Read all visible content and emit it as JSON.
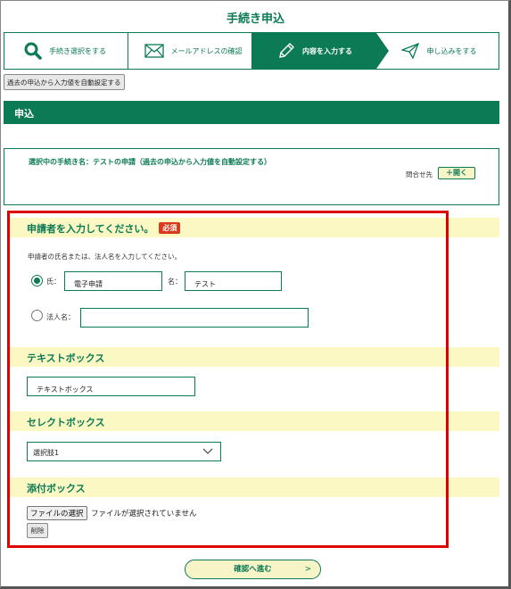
{
  "page": {
    "title": "手続き申込"
  },
  "steps": [
    {
      "label": "手続き選択をする",
      "icon": "search-icon",
      "active": false
    },
    {
      "label": "メールアドレスの確認",
      "icon": "mail-icon",
      "active": false
    },
    {
      "label": "内容を入力する",
      "icon": "pencil-icon",
      "active": true
    },
    {
      "label": "申し込みをする",
      "icon": "send-icon",
      "active": false
    }
  ],
  "autofill_button": "過去の申込から入力値を自動設定する",
  "section": {
    "title": "申込"
  },
  "info": {
    "procedure_label": "選択中の手続き名：",
    "procedure_name": "テストの申請（過去の申込から入力値を自動設定する）",
    "contact_label": "問合せ先",
    "open_button": "開く"
  },
  "applicant": {
    "heading": "申請者を入力してください。",
    "required_badge": "必須",
    "hint": "申請者の氏名または、法人名を入力してください。",
    "surname_label": "氏：",
    "surname_value": "電子申請",
    "given_label": "名：",
    "given_value": "テスト",
    "corp_label": "法人名：",
    "corp_value": ""
  },
  "textbox": {
    "heading": "テキストボックス",
    "value": "テキストボックス"
  },
  "selectbox": {
    "heading": "セレクトボックス",
    "selected": "選択肢1"
  },
  "attachment": {
    "heading": "添付ボックス",
    "choose_button": "ファイルの選択",
    "status": "ファイルが選択されていません",
    "delete_button": "削除"
  },
  "confirm_button": "確認へ進む",
  "colors": {
    "brand_green": "#0b7a55",
    "band_yellow": "#fbf8c4",
    "required_red": "#d93a1c",
    "highlight_red": "#e00000"
  }
}
